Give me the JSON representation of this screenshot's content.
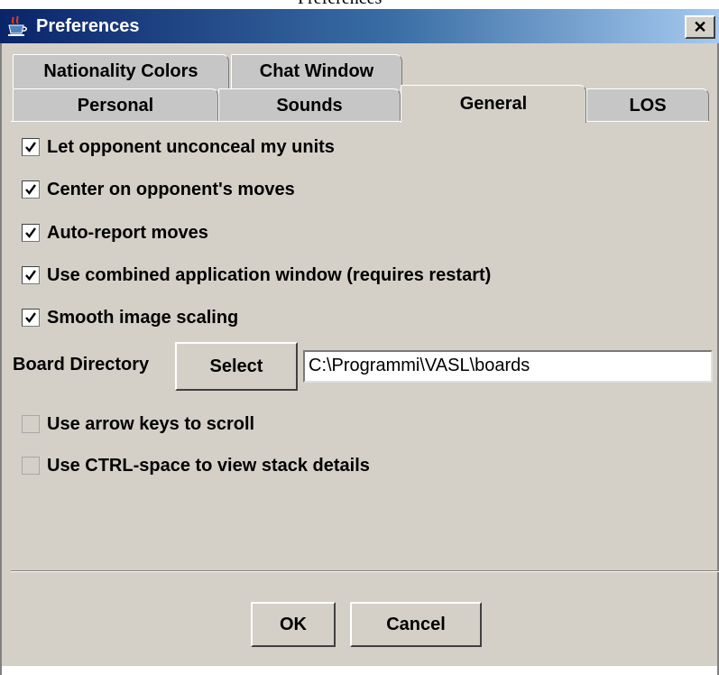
{
  "caption": {
    "text": "Preferences"
  },
  "window": {
    "title": "Preferences",
    "close_glyph": "✕"
  },
  "tabs": {
    "row_back": [
      "Nationality Colors",
      "Chat Window"
    ],
    "row_front": [
      "Personal",
      "Sounds",
      "General",
      "LOS"
    ],
    "selected": "General"
  },
  "general": {
    "options": [
      {
        "label": "Let opponent unconceal my units",
        "checked": true
      },
      {
        "label": "Center on opponent's moves",
        "checked": true
      },
      {
        "label": "Auto-report moves",
        "checked": true
      },
      {
        "label": "Use combined application window (requires restart)",
        "checked": true
      },
      {
        "label": "Smooth image scaling",
        "checked": true
      },
      {
        "label": "Use arrow keys to scroll",
        "checked": false
      },
      {
        "label": "Use CTRL-space to view stack details",
        "checked": false
      }
    ],
    "board_directory": {
      "label": "Board Directory",
      "button": "Select",
      "value": "C:\\Programmi\\VASL\\boards"
    }
  },
  "buttons": {
    "ok": "OK",
    "cancel": "Cancel"
  },
  "icons": {
    "app": "java-coffee-icon",
    "close": "close-icon",
    "check": "checkmark-icon"
  }
}
